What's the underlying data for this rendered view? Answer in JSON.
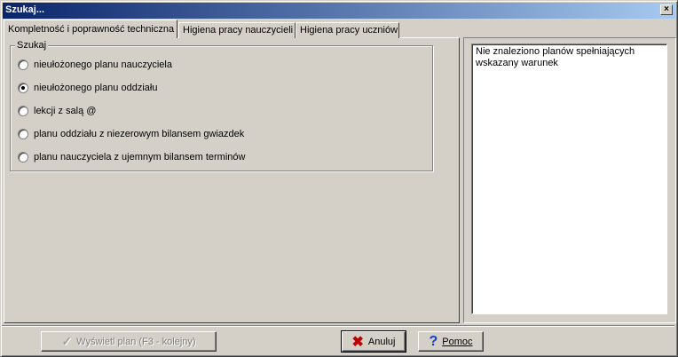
{
  "window": {
    "title": "Szukaj...",
    "close_label": "×"
  },
  "tabs": [
    {
      "label": "Kompletność i poprawność techniczna",
      "active": true
    },
    {
      "label": "Higiena pracy nauczycieli",
      "active": false
    },
    {
      "label": "Higiena pracy uczniów",
      "active": false
    }
  ],
  "search_group": {
    "label": "Szukaj",
    "options": [
      {
        "label": "nieułożonego planu nauczyciela",
        "checked": false
      },
      {
        "label": "nieułożonego planu oddziału",
        "checked": true
      },
      {
        "label": "lekcji z salą @",
        "checked": false
      },
      {
        "label": "planu oddziału z niezerowym bilansem gwiazdek",
        "checked": false
      },
      {
        "label": "planu nauczyciela z ujemnym bilansem terminów",
        "checked": false
      }
    ]
  },
  "result": {
    "text": "Nie znaleziono planów spełniających wskazany warunek"
  },
  "buttons": {
    "show_plan": {
      "label": "Wyświetl plan (F3 - kolejny)",
      "icon": "check-icon"
    },
    "cancel": {
      "label": "Anuluj",
      "icon": "x-icon"
    },
    "help": {
      "label": "Pomoc",
      "icon": "question-icon"
    }
  },
  "colors": {
    "titlebar_start": "#0a246a",
    "titlebar_end": "#a6caf0",
    "face": "#d4d0c8"
  }
}
